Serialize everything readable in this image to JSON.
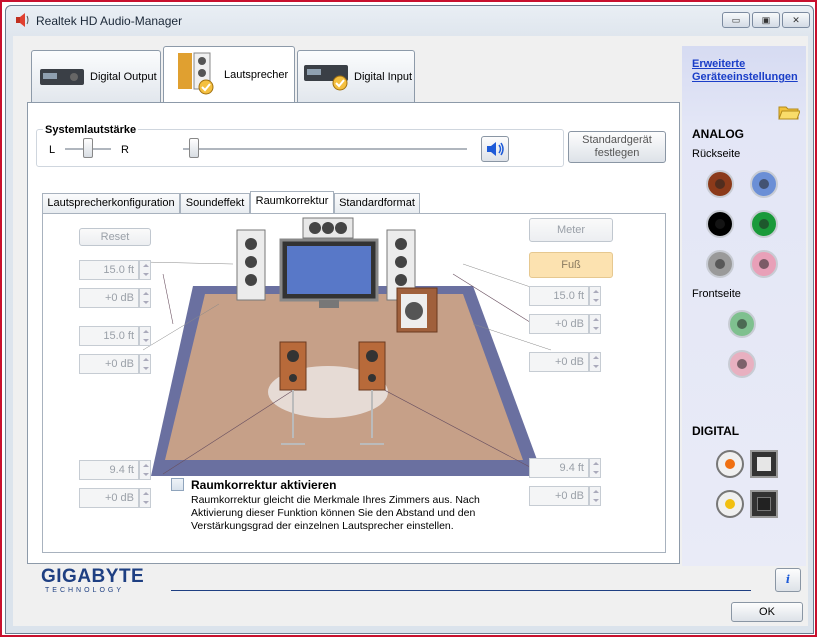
{
  "window": {
    "title": "Realtek HD Audio-Manager",
    "buttons": {
      "minimize": "▭",
      "restore": "▣",
      "close": "✕"
    }
  },
  "device_tabs": [
    {
      "label": "Digital Output"
    },
    {
      "label": "Lautsprecher"
    },
    {
      "label": "Digital Input"
    }
  ],
  "volume": {
    "group_label": "Systemlautstärke",
    "left": "L",
    "right": "R",
    "balance": 0.5,
    "level": 0.02
  },
  "default_device_button": "Standardgerät festlegen",
  "sub_tabs": [
    {
      "label": "Lautsprecherkonfiguration"
    },
    {
      "label": "Soundeffekt"
    },
    {
      "label": "Raumkorrektur"
    },
    {
      "label": "Standardformat"
    }
  ],
  "room": {
    "reset_label": "Reset",
    "meter_label": "Meter",
    "foot_label": "Fuß",
    "left_fields": [
      {
        "distance": "15.0 ft",
        "gain": "+0 dB"
      },
      {
        "distance": "15.0 ft",
        "gain": "+0 dB"
      },
      {
        "distance": "9.4 ft",
        "gain": "+0 dB"
      }
    ],
    "right_fields": [
      {
        "distance": "15.0 ft",
        "gain": "+0 dB"
      },
      {
        "gain": "+0 dB"
      },
      {
        "distance": "9.4 ft",
        "gain": "+0 dB"
      }
    ],
    "enable_label": "Raumkorrektur aktivieren",
    "description": "Raumkorrektur gleicht die Merkmale Ihres Zimmers aus. Nach Aktivierung dieser Funktion können Sie den Abstand und den Verstärkungsgrad der einzelnen Lautsprecher einstellen."
  },
  "sidebar": {
    "advanced_link_line1": "Erweiterte",
    "advanced_link_line2": "Geräteeinstellungen",
    "analog_heading": "ANALOG",
    "rear_label": "Rückseite",
    "front_label": "Frontseite",
    "digital_heading": "DIGITAL",
    "rear_jacks": [
      "#8b3a1a",
      "#6b8fd6",
      "#000000",
      "#1a9a3a",
      "#9a9a9a",
      "#e8a0b8"
    ],
    "front_jacks": [
      "#7fc08f",
      "#e8b0c0"
    ]
  },
  "footer": {
    "brand": "GIGABYTE",
    "brand_sub": "TECHNOLOGY",
    "ok_label": "OK",
    "info_icon_char": "i"
  }
}
